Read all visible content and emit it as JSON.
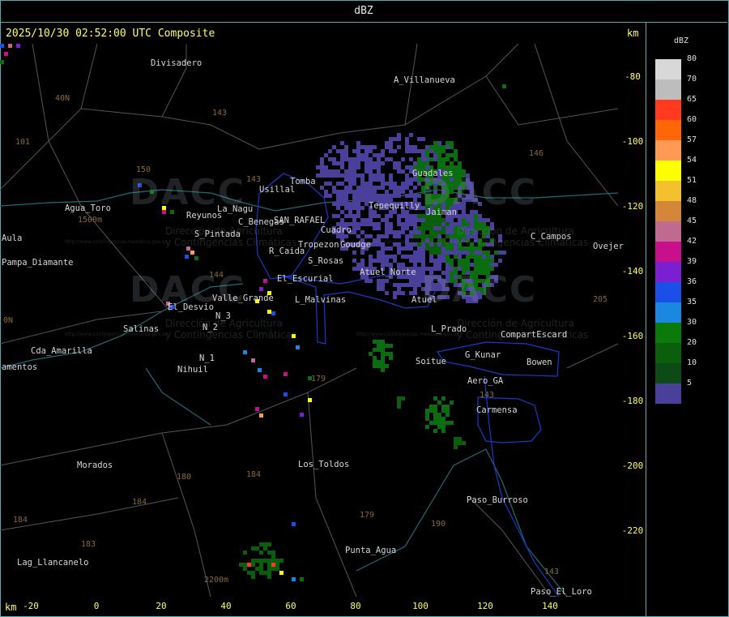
{
  "header": {
    "title": "dBZ"
  },
  "map": {
    "timestamp": "2025/10/30 02:52:00 UTC Composite",
    "km_label": "km",
    "x_ticks": [
      "-20",
      "0",
      "20",
      "40",
      "60",
      "80",
      "100",
      "120",
      "140"
    ],
    "y_ticks": [
      "-80",
      "-100",
      "-120",
      "-140",
      "-160",
      "-180",
      "-200",
      "-220"
    ],
    "watermark": {
      "logo": "DACC",
      "line1": "Dirección de Agricultura",
      "line2": "y Contingencias Climáticas",
      "url": "http://www.contingencias.mendoza.gov.ar"
    },
    "places": [
      "Divisadero",
      "A_Villanueva",
      "Guadales",
      "Tomba",
      "Usillal",
      "Agua_Toro",
      "Reyunos",
      "La_Nagu",
      "C_Benegas",
      "SAN_RAFAEL",
      "S_Pintada",
      "Tropezon",
      "Goudge",
      "R_Caida",
      "S_Rosas",
      "Cuadro",
      "Atuel_Norte",
      "Tepequilly",
      "Jaiman",
      "C_Campos",
      "Ovejer",
      "Aula",
      "Pampa_Diamante",
      "El_Escurial",
      "Valle_Grande",
      "L_Malvinas",
      "Atuel",
      "El_Desvio",
      "Salinas",
      "N_2",
      "N_3",
      "N_1",
      "Nihuil",
      "Cda_Amarilla",
      "amentos",
      "L_Prado",
      "CompartEscard",
      "Soitue",
      "G_Kunar",
      "Bowen",
      "Aero_GA",
      "Carmensa",
      "Morados",
      "Los_Toldos",
      "Paso_Burroso",
      "Punta_Agua",
      "Lag_Llancanelo",
      "Paso_El_Loro",
      "40N",
      "0N"
    ],
    "routes": [
      "143",
      "101",
      "150",
      "146",
      "143",
      "144",
      "179",
      "180",
      "184",
      "184",
      "183",
      "190",
      "179",
      "143",
      "143",
      "205",
      "184",
      "1500m",
      "2200m"
    ]
  },
  "legend": {
    "title": "dBZ",
    "items": [
      {
        "label": "80",
        "color": "#d8d8d8"
      },
      {
        "label": "70",
        "color": "#bdbdbd"
      },
      {
        "label": "65",
        "color": "#ff3a1e"
      },
      {
        "label": "60",
        "color": "#ff6608"
      },
      {
        "label": "57",
        "color": "#ff9a55"
      },
      {
        "label": "54",
        "color": "#ffff00"
      },
      {
        "label": "51",
        "color": "#f5c02e"
      },
      {
        "label": "48",
        "color": "#d4863a"
      },
      {
        "label": "45",
        "color": "#c06a90"
      },
      {
        "label": "42",
        "color": "#c80f8c"
      },
      {
        "label": "39",
        "color": "#7a20d0"
      },
      {
        "label": "36",
        "color": "#1c4fe8"
      },
      {
        "label": "35",
        "color": "#1a88e0"
      },
      {
        "label": "30",
        "color": "#0a7a0a"
      },
      {
        "label": "20",
        "color": "#0b5e0b"
      },
      {
        "label": "10",
        "color": "#0c4a16"
      },
      {
        "label": "5",
        "color": "#4a3f9a"
      }
    ]
  }
}
